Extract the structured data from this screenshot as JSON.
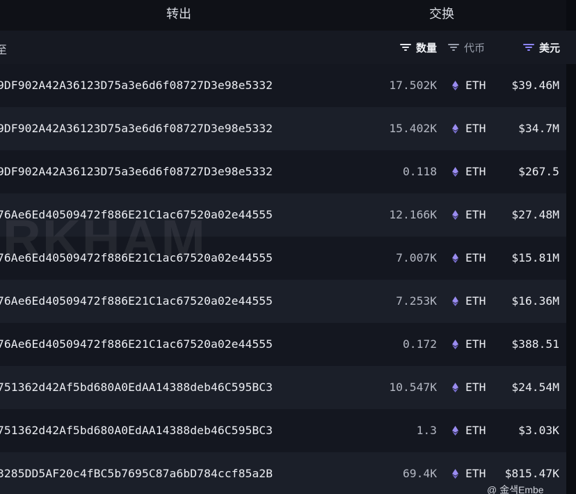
{
  "tabs": {
    "transfer": "转出",
    "exchange": "交换"
  },
  "header": {
    "from": "至",
    "quantity": "数量",
    "token": "代币",
    "usd": "美元"
  },
  "rows": [
    {
      "address": "9DF902A42A36123D75a3e6d6f08727D3e98e5332",
      "quantity": "17.502K",
      "token": "ETH",
      "usd": "$39.46M"
    },
    {
      "address": "9DF902A42A36123D75a3e6d6f08727D3e98e5332",
      "quantity": "15.402K",
      "token": "ETH",
      "usd": "$34.7M"
    },
    {
      "address": "9DF902A42A36123D75a3e6d6f08727D3e98e5332",
      "quantity": "0.118",
      "token": "ETH",
      "usd": "$267.5"
    },
    {
      "address": "76Ae6Ed40509472f886E21C1ac67520a02e44555",
      "quantity": "12.166K",
      "token": "ETH",
      "usd": "$27.48M"
    },
    {
      "address": "76Ae6Ed40509472f886E21C1ac67520a02e44555",
      "quantity": "7.007K",
      "token": "ETH",
      "usd": "$15.81M"
    },
    {
      "address": "76Ae6Ed40509472f886E21C1ac67520a02e44555",
      "quantity": "7.253K",
      "token": "ETH",
      "usd": "$16.36M"
    },
    {
      "address": "76Ae6Ed40509472f886E21C1ac67520a02e44555",
      "quantity": "0.172",
      "token": "ETH",
      "usd": "$388.51"
    },
    {
      "address": "751362d42Af5bd680A0EdAA14388deb46C595BC3",
      "quantity": "10.547K",
      "token": "ETH",
      "usd": "$24.54M"
    },
    {
      "address": "751362d42Af5bd680A0EdAA14388deb46C595BC3",
      "quantity": "1.3",
      "token": "ETH",
      "usd": "$3.03K"
    },
    {
      "address": "3285DD5AF20c4fBC5b7695C87a6bD784ccf85a2B",
      "quantity": "69.4K",
      "token": "ETH",
      "usd": "$815.47K"
    }
  ],
  "watermark": "RKHAM",
  "credit": "@ 金색Embe",
  "icons": {
    "token": "eth-icon",
    "filter": "filter-icon"
  },
  "colors": {
    "accent": "#8f86ff",
    "background": "#141720",
    "row_alt": "#1b1f29"
  }
}
